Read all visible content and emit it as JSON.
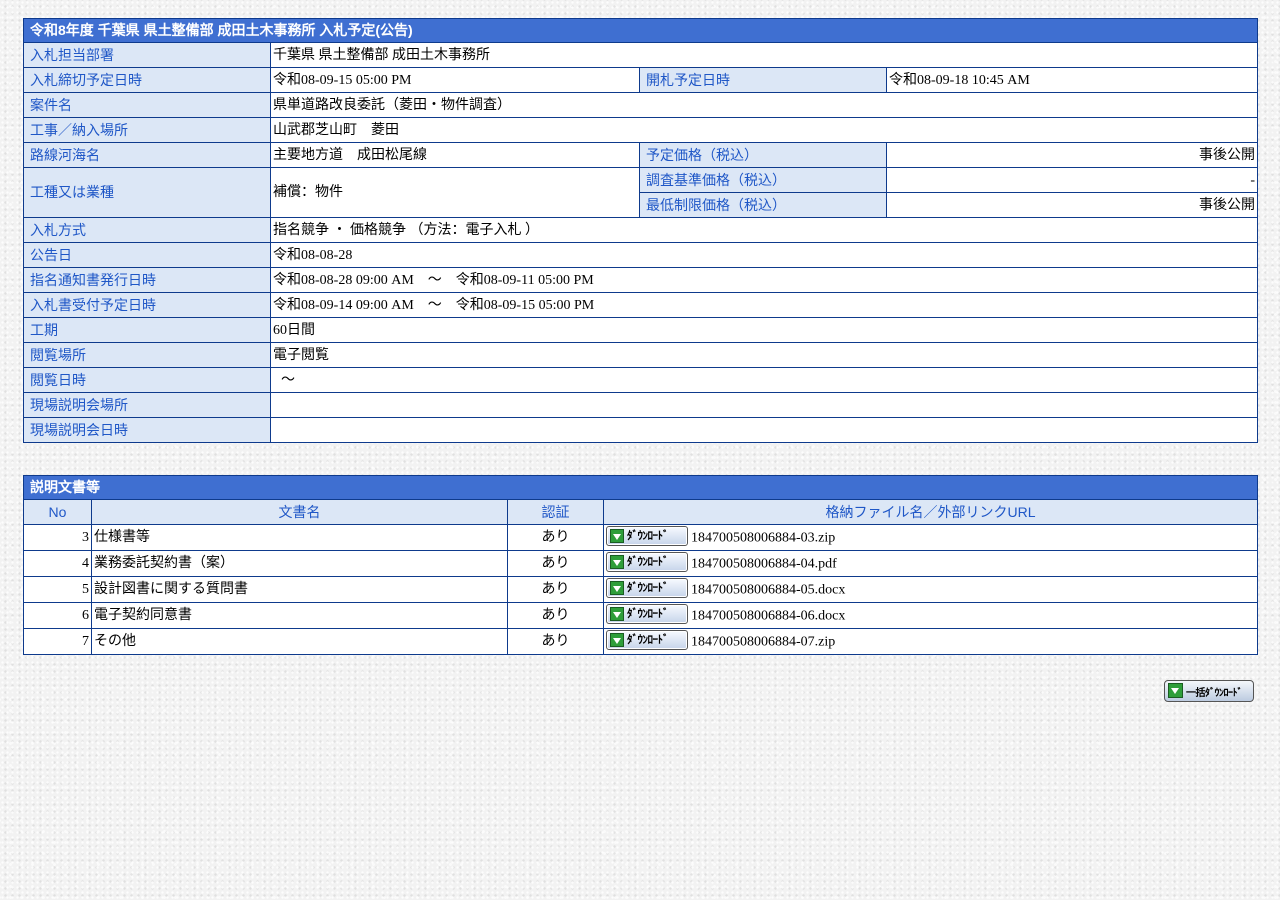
{
  "info": {
    "title": "令和8年度 千葉県 県土整備部 成田土木事務所 入札予定(公告)",
    "rows": {
      "dept": {
        "label": "入札担当部署",
        "value": "千葉県 県土整備部 成田土木事務所"
      },
      "deadline": {
        "label": "入札締切予定日時",
        "value": "令和08-09-15 05:00 PM"
      },
      "opening": {
        "label": "開札予定日時",
        "value": "令和08-09-18 10:45 AM"
      },
      "case_name": {
        "label": "案件名",
        "value": "県単道路改良委託（菱田・物件調査）"
      },
      "location": {
        "label": "工事／納入場所",
        "value": "山武郡芝山町　菱田"
      },
      "route": {
        "label": "路線河海名",
        "value": "主要地方道　成田松尾線"
      },
      "est_price": {
        "label": "予定価格（税込）",
        "value": "事後公開"
      },
      "work_type": {
        "label": "工種又は業種",
        "value": "補償：物件"
      },
      "survey_price": {
        "label": "調査基準価格（税込）",
        "value": "-"
      },
      "min_price": {
        "label": "最低制限価格（税込）",
        "value": "事後公開"
      },
      "method": {
        "label": "入札方式",
        "value": "指名競争 ・ 価格競争 （方法：電子入札 ）"
      },
      "notice_date": {
        "label": "公告日",
        "value": "令和08-08-28"
      },
      "nomination": {
        "label": "指名通知書発行日時",
        "value": "令和08-08-28 09:00 AM　～　令和08-09-11 05:00 PM"
      },
      "receipt": {
        "label": "入札書受付予定日時",
        "value": "令和08-09-14 09:00 AM　～　令和08-09-15 05:00 PM"
      },
      "period": {
        "label": "工期",
        "value": "60日間"
      },
      "view_place": {
        "label": "閲覧場所",
        "value": "電子閲覧"
      },
      "view_date": {
        "label": "閲覧日時",
        "value": "～"
      },
      "brief_place": {
        "label": "現場説明会場所",
        "value": ""
      },
      "brief_date": {
        "label": "現場説明会日時",
        "value": ""
      }
    }
  },
  "docs": {
    "title": "説明文書等",
    "headers": {
      "no": "No",
      "name": "文書名",
      "auth": "認証",
      "file": "格納ファイル名／外部リンクURL"
    },
    "download_label": "ﾀﾞｳﾝﾛｰﾄﾞ",
    "items": [
      {
        "no": "3",
        "name": "仕様書等",
        "auth": "あり",
        "file": "184700508006884-03.zip"
      },
      {
        "no": "4",
        "name": "業務委託契約書（案）",
        "auth": "あり",
        "file": "184700508006884-04.pdf"
      },
      {
        "no": "5",
        "name": "設計図書に関する質問書",
        "auth": "あり",
        "file": "184700508006884-05.docx"
      },
      {
        "no": "6",
        "name": "電子契約同意書",
        "auth": "あり",
        "file": "184700508006884-06.docx"
      },
      {
        "no": "7",
        "name": "その他",
        "auth": "あり",
        "file": "184700508006884-07.zip"
      }
    ]
  },
  "bulk_download_label": "一括ﾀﾞｳﾝﾛｰﾄﾞ",
  "colors": {
    "header_bg": "#3f6fd1",
    "label_bg": "#dce7f6",
    "label_text": "#1f57c7",
    "border": "#0e3a8c"
  }
}
